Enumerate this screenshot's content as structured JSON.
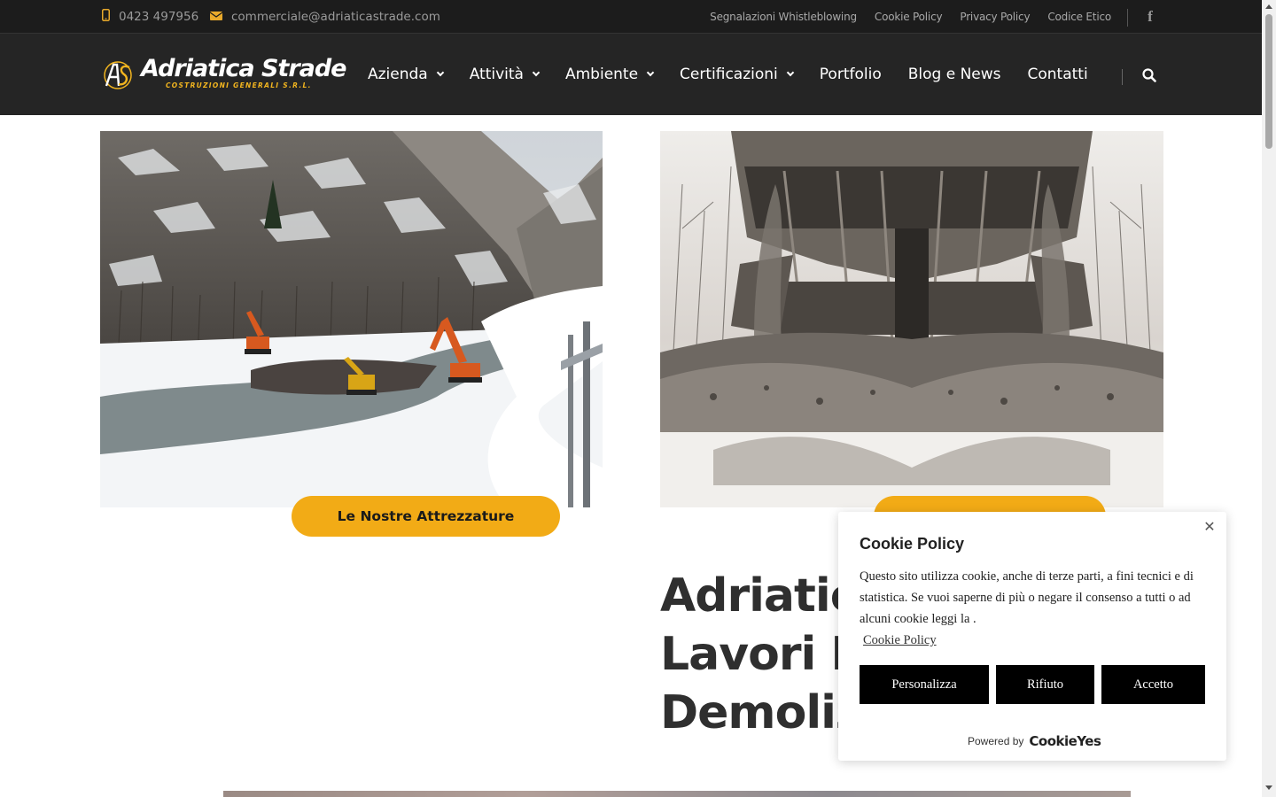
{
  "topbar": {
    "phone": "0423 497956",
    "email": "commerciale@adriaticastrade.com",
    "links": [
      "Segnalazioni Whistleblowing",
      "Cookie Policy",
      "Privacy Policy",
      "Codice Etico"
    ],
    "facebook_icon": "facebook-icon"
  },
  "header": {
    "logo_name": "Adriatica Strade",
    "logo_subtitle": "COSTRUZIONI GENERALI S.R.L.",
    "nav": [
      "Azienda",
      "Attività",
      "Ambiente",
      "Certificazioni",
      "Portfolio",
      "Blog e News",
      "Contatti"
    ],
    "search_icon": "search-icon"
  },
  "main": {
    "button_left": "Le Nostre Attrezzature",
    "headline": "Adriatic\nLavori E\nDemoliz"
  },
  "cookie": {
    "title": "Cookie Policy",
    "body": "Questo sito utilizza cookie, anche di terze parti, a fini tecnici e di statistica. Se vuoi saperne di più o negare il consenso a tutti o ad alcuni cookie leggi la .",
    "link": "Cookie Policy",
    "buttons": [
      "Personalizza",
      "Rifiuto",
      "Accetto"
    ],
    "powered_by": "Powered by",
    "brand": "CookieYes"
  },
  "colors": {
    "accent": "#f2ab16",
    "topbar_bg": "#1c1c1c",
    "header_bg": "#252525"
  }
}
